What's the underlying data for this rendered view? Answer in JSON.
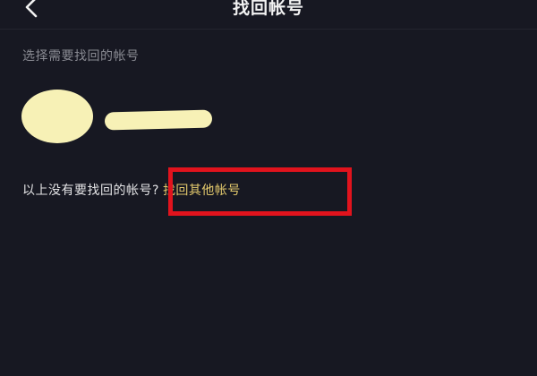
{
  "nav": {
    "title": "找回帐号",
    "back_icon": "chevron-left-icon"
  },
  "section": {
    "label": "选择需要找回的帐号"
  },
  "hint": {
    "text": "以上没有要找回的帐号?",
    "link": "找回其他帐号"
  },
  "colors": {
    "background": "#171822",
    "link": "#e3c96c",
    "highlight": "#e1131d",
    "redaction": "#f7f1b6"
  }
}
